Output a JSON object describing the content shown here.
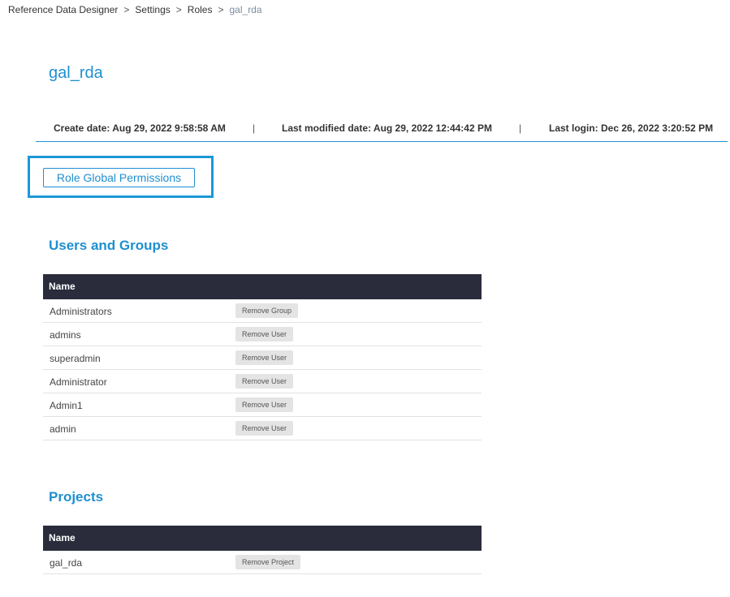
{
  "breadcrumb": {
    "items": [
      "Reference Data Designer",
      "Settings",
      "Roles"
    ],
    "current": "gal_rda",
    "separator": ">"
  },
  "page": {
    "title": "gal_rda"
  },
  "meta": {
    "create_date": "Create date: Aug 29, 2022 9:58:58 AM",
    "last_modified": "Last modified date: Aug 29, 2022 12:44:42 PM",
    "last_login": "Last login: Dec 26, 2022 3:20:52 PM",
    "separator": "|"
  },
  "actions": {
    "role_global_permissions": "Role Global Permissions"
  },
  "users_groups": {
    "title": "Users and Groups",
    "column_name": "Name",
    "rows": [
      {
        "name": "Administrators",
        "action": "Remove Group"
      },
      {
        "name": "admins",
        "action": "Remove User"
      },
      {
        "name": "superadmin",
        "action": "Remove User"
      },
      {
        "name": "Administrator",
        "action": "Remove User"
      },
      {
        "name": "Admin1",
        "action": "Remove User"
      },
      {
        "name": "admin",
        "action": "Remove User"
      }
    ]
  },
  "projects": {
    "title": "Projects",
    "column_name": "Name",
    "rows": [
      {
        "name": "gal_rda",
        "action": "Remove Project"
      }
    ]
  },
  "colors": {
    "accent": "#1f8fd1",
    "highlight": "#1c98d8",
    "table_header": "#2a2c3c",
    "button_bg": "#e4e4e4"
  }
}
